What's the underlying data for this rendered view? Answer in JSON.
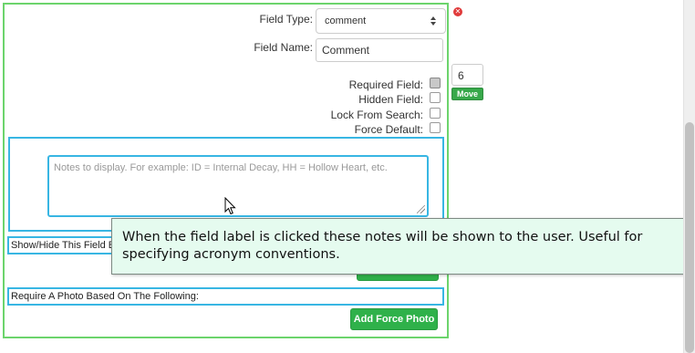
{
  "field": {
    "type_label": "Field Type:",
    "type_value": "comment",
    "name_label": "Field Name:",
    "name_value": "Comment"
  },
  "order": {
    "value": "6",
    "move_label": "Move"
  },
  "checkboxes": [
    {
      "label": "Required Field:",
      "checked": false
    },
    {
      "label": "Hidden Field:",
      "checked": false
    },
    {
      "label": "Lock From Search:",
      "checked": false
    },
    {
      "label": "Force Default:",
      "checked": false
    }
  ],
  "notes": {
    "placeholder": "Notes to display. For example: ID = Internal Decay, HH = Hollow Heart, etc."
  },
  "rules": {
    "show_hide_label": "Show/Hide This Field B",
    "photo_label": "Require A Photo Based On The Following:",
    "add_force_photo_label": "Add Force Photo"
  },
  "tooltip": {
    "text": "When the field label is clicked these notes will be shown to the user. Useful for specifying acronym conventions."
  },
  "colors": {
    "panel_border": "#6cd46c",
    "section_border": "#38b6e3",
    "button_green": "#2fb14a",
    "tooltip_bg": "#e5fbef",
    "remove_red": "#e03a3a"
  }
}
